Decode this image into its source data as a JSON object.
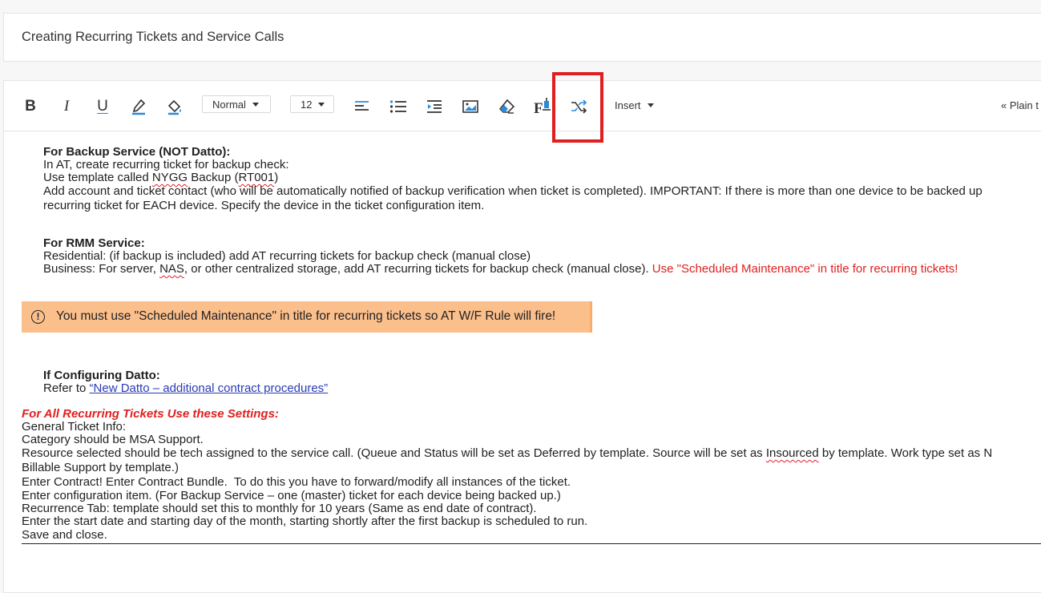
{
  "title": "Creating Recurring Tickets and Service Calls",
  "toolbar": {
    "bold_icon": "bold-icon",
    "italic_icon": "italic-icon",
    "underline_icon": "underline-icon",
    "text_color_icon": "text-color-icon",
    "fill_color_icon": "fill-color-icon",
    "style_value": "Normal",
    "size_value": "12",
    "insert_label": "Insert",
    "plain_text_label": "« Plain t",
    "accent": "#2b8bd8",
    "highlight_color": "#e02020"
  },
  "content": {
    "backup_heading": "For Backup Service (NOT Datto):",
    "backup_l1": "In AT, create recurring ticket for backup check:",
    "backup_l2a": "Use template called ",
    "backup_l2b": "NYGG",
    "backup_l2c": " Backup (",
    "backup_l2d": "RT001",
    "backup_l2e": ")",
    "backup_l3": "Add account and ticket contact (who will be automatically notified of backup verification when ticket is completed). IMPORTANT: If there is more than one device to be backed up",
    "backup_l4": "recurring ticket for EACH device. Specify the device in the ticket configuration item.",
    "rmm_heading": "For RMM Service:",
    "rmm_l1": "Residential: (if backup is included) add AT recurring tickets for backup check (manual close)",
    "rmm_l2a": "Business: For server, ",
    "rmm_l2b": "NAS",
    "rmm_l2c": ", or other centralized storage, add AT recurring tickets for backup check (manual close). ",
    "rmm_l2_red": "Use \"Scheduled Maintenance\" in title for recurring tickets!",
    "alert_text": "You must use \"Scheduled Maintenance\" in title for recurring tickets so AT W/F Rule will fire!",
    "datto_heading": "If Configuring Datto:",
    "datto_refer": "Refer to ",
    "datto_link": "“New Datto – additional contract procedures”",
    "settings_heading": "For All Recurring Tickets Use these Settings:",
    "s1": "General Ticket Info:",
    "s2": "Category should be MSA Support.",
    "s3a": "Resource selected should be tech assigned to the service call. (Queue and Status will be set as Deferred by template. Source will be set as ",
    "s3b": "Insourced",
    "s3c": " by template. Work type set as N",
    "s4": "Billable Support by template.)",
    "s5": "Enter Contract! Enter Contract Bundle.  To do this you have to forward/modify all instances of the ticket.",
    "s6": "Enter configuration item. (For Backup Service – one (master) ticket for each device being backed up.)",
    "s7": "Recurrence Tab: template should set this to monthly for 10 years (Same as end date of contract).",
    "s8": "Enter the start date and starting day of the month, starting shortly after the first backup is scheduled to run.",
    "s9": "Save and close."
  }
}
